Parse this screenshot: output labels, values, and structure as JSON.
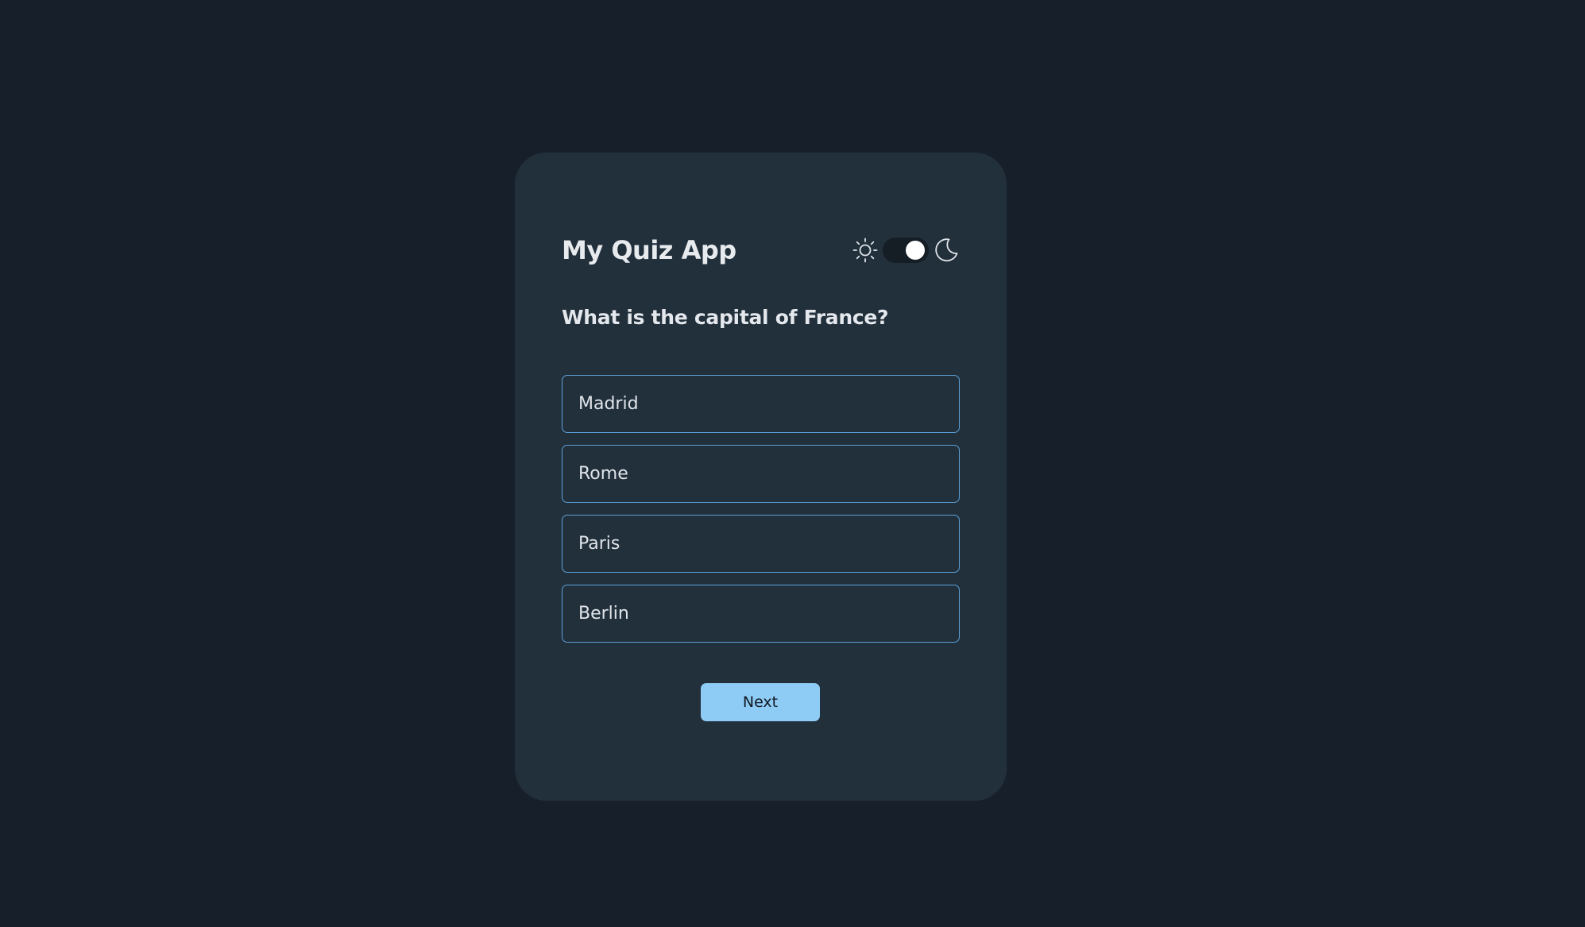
{
  "app": {
    "title": "My Quiz App"
  },
  "theme": {
    "light_icon": "sun-icon",
    "dark_icon": "moon-icon",
    "toggle_state": "dark"
  },
  "quiz": {
    "question": "What is the capital of France?",
    "options": [
      {
        "label": "Madrid"
      },
      {
        "label": "Rome"
      },
      {
        "label": "Paris"
      },
      {
        "label": "Berlin"
      }
    ],
    "next_label": "Next"
  },
  "colors": {
    "page_background": "#17202a",
    "card_background": "#22303c",
    "option_border": "#5b9fd6",
    "button_background": "#8ecbf5",
    "text": "#e4e8ec"
  }
}
